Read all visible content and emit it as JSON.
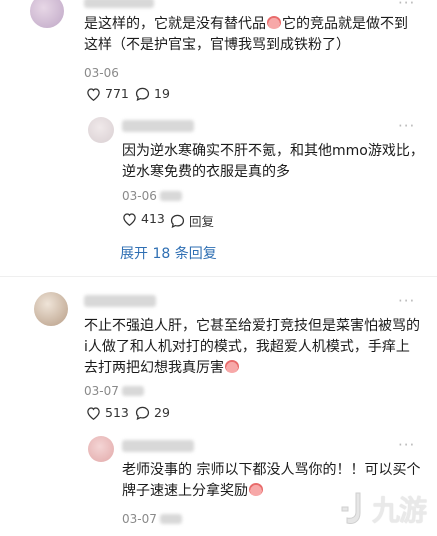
{
  "comments": [
    {
      "text_line1": "是这样的，它就是没有替代品",
      "text_line1b": "它的竞品就是做不到",
      "text_line2": "这样（不是护官宝，官博我骂到成铁粉了）",
      "date": "03-06",
      "likes": "771",
      "replies": "19"
    },
    {
      "text_line1": "因为逆水寒确实不肝不氪，和其他mmo游戏比，",
      "text_line2": "逆水寒免费的衣服是真的多",
      "date": "03-06",
      "likes": "413",
      "reply_label": "回复",
      "expand_label": "展开 18 条回复"
    },
    {
      "text_line1": "不止不强迫人肝，它甚至给爱打竞技但是菜害怕被骂的",
      "text_line2": "i人做了和人机对打的模式，我超爱人机模式，手痒上",
      "text_line3": "去打两把幻想我真厉害",
      "date": "03-07",
      "likes": "513",
      "replies": "29"
    },
    {
      "text_line1": "老师没事的 宗师以下都没人骂你的！！可以买个",
      "text_line2": "牌子速速上分拿奖励",
      "date": "03-07"
    }
  ],
  "more_label": "···",
  "watermark": "九游",
  "colors": {
    "link": "#2f6fb3",
    "muted": "#8a8a8a"
  }
}
